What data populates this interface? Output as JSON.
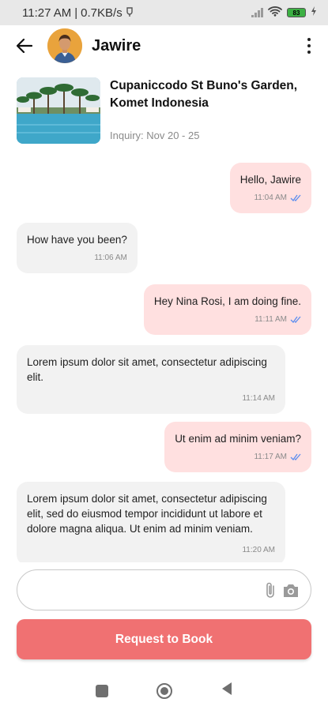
{
  "status_bar": {
    "time": "11:27 AM",
    "separator": "|",
    "network_speed": "0.7KB/s",
    "battery_level": "83"
  },
  "header": {
    "contact_name": "Jawire"
  },
  "listing": {
    "title": "Cupaniccodo St Buno's Garden, Komet Indonesia",
    "inquiry": "Inquiry: Nov 20 - 25"
  },
  "messages": [
    {
      "direction": "out",
      "text": "Hello, Jawire",
      "time": "11:04 AM",
      "read": true
    },
    {
      "direction": "in",
      "text": "How have you been?",
      "time": "11:06 AM"
    },
    {
      "direction": "out",
      "text": "Hey Nina Rosi, I am doing fine.",
      "time": "11:11 AM",
      "read": true
    },
    {
      "direction": "in",
      "text": "Lorem ipsum dolor sit amet, consectetur adipiscing elit.",
      "time": "11:14 AM"
    },
    {
      "direction": "out",
      "text": "Ut enim ad minim veniam?",
      "time": "11:17 AM",
      "read": true
    },
    {
      "direction": "in",
      "text": "Lorem ipsum dolor sit amet, consectetur adipiscing elit, sed do eiusmod tempor incididunt ut labore et dolore magna aliqua. Ut enim ad minim veniam.",
      "time": "11:20 AM"
    }
  ],
  "composer": {
    "value": "",
    "placeholder": ""
  },
  "book_button": {
    "label": "Request to Book"
  },
  "colors": {
    "outgoing_bubble": "#ffe0e0",
    "incoming_bubble": "#f2f2f2",
    "primary_button": "#f07172",
    "read_check": "#5b8def"
  },
  "icons": {
    "back": "arrow-left-icon",
    "more": "more-vertical-icon",
    "attach": "paperclip-icon",
    "camera": "camera-icon",
    "read_receipt": "double-check-icon"
  }
}
